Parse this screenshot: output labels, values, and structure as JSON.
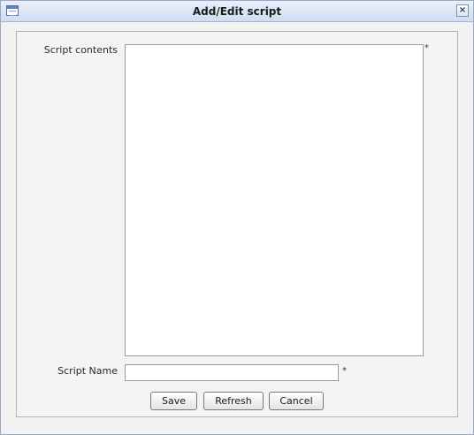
{
  "window": {
    "title": "Add/Edit script",
    "close_label": "×"
  },
  "form": {
    "contents_label": "Script contents",
    "contents_value": "",
    "contents_required": "*",
    "name_label": "Script Name",
    "name_value": "",
    "name_required": "*"
  },
  "buttons": {
    "save_label": "Save",
    "refresh_label": "Refresh",
    "cancel_label": "Cancel"
  },
  "icons": {
    "window_icon": "window-icon",
    "close_icon": "close-icon"
  }
}
